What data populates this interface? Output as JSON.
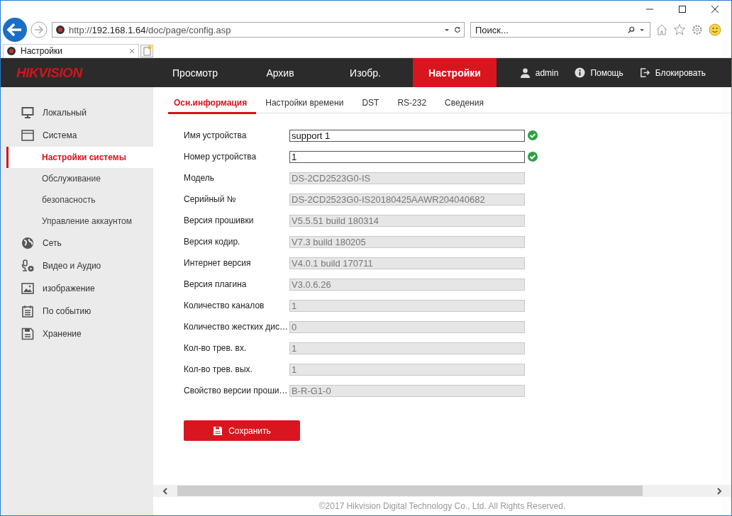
{
  "browser": {
    "url_scheme": "http://",
    "url_host": "192.168.1.64",
    "url_path": "/doc/page/config.asp",
    "search": {
      "placeholder": "Поиск..."
    },
    "tab_title": "Настройки"
  },
  "header": {
    "logo": "HIKVISION",
    "nav": [
      {
        "label": "Просмотр",
        "selected": false
      },
      {
        "label": "Архив",
        "selected": false
      },
      {
        "label": "Изобр.",
        "selected": false
      },
      {
        "label": "Настройки",
        "selected": true
      }
    ],
    "user": "admin",
    "help": "Помощь",
    "lock": "Блокировать"
  },
  "sidebar": {
    "items": [
      {
        "label": "Локальный",
        "kind": "monitor"
      },
      {
        "label": "Система",
        "kind": "window",
        "children": [
          {
            "label": "Настройки системы",
            "selected": true
          },
          {
            "label": "Обслуживание",
            "selected": false
          },
          {
            "label": "безопасность",
            "selected": false
          },
          {
            "label": "Управление аккаунтом",
            "selected": false
          }
        ]
      },
      {
        "label": "Сеть",
        "kind": "globe"
      },
      {
        "label": "Видео и Аудио",
        "kind": "mic"
      },
      {
        "label": "изображение",
        "kind": "image"
      },
      {
        "label": "По событию",
        "kind": "calendar"
      },
      {
        "label": "Хранение",
        "kind": "disk"
      }
    ]
  },
  "tabs": [
    {
      "label": "Осн.информация",
      "selected": true
    },
    {
      "label": "Настройки времени",
      "selected": false
    },
    {
      "label": "DST",
      "selected": false
    },
    {
      "label": "RS-232",
      "selected": false
    },
    {
      "label": "Сведения",
      "selected": false
    }
  ],
  "fields": [
    {
      "label": "Имя устройства",
      "value": "support 1",
      "disabled": false,
      "valid": true
    },
    {
      "label": "Номер устройства",
      "value": "1",
      "disabled": false,
      "valid": true
    },
    {
      "label": "Модель",
      "value": "DS-2CD2523G0-IS",
      "disabled": true,
      "valid": false
    },
    {
      "label": "Серийный №",
      "value": "DS-2CD2523G0-IS20180425AAWR204040682",
      "disabled": true,
      "valid": false
    },
    {
      "label": "Версия прошивки",
      "value": "V5.5.51 build 180314",
      "disabled": true,
      "valid": false
    },
    {
      "label": "Версия кодир.",
      "value": "V7.3 build 180205",
      "disabled": true,
      "valid": false
    },
    {
      "label": "Интернет версия",
      "value": "V4.0.1 build 170711",
      "disabled": true,
      "valid": false
    },
    {
      "label": "Версия плагина",
      "value": "V3.0.6.26",
      "disabled": true,
      "valid": false
    },
    {
      "label": "Количество каналов",
      "value": "1",
      "disabled": true,
      "valid": false
    },
    {
      "label": "Количество жестких дис…",
      "value": "0",
      "disabled": true,
      "valid": false
    },
    {
      "label": "Кол-во трев. вх.",
      "value": "1",
      "disabled": true,
      "valid": false
    },
    {
      "label": "Кол-во трев. вых.",
      "value": "1",
      "disabled": true,
      "valid": false
    },
    {
      "label": "Свойство версии проши…",
      "value": "B-R-G1-0",
      "disabled": true,
      "valid": false
    }
  ],
  "save_button": "Сохранить",
  "footer": "©2017 Hikvision Digital Technology Co., Ltd. All Rights Reserved."
}
